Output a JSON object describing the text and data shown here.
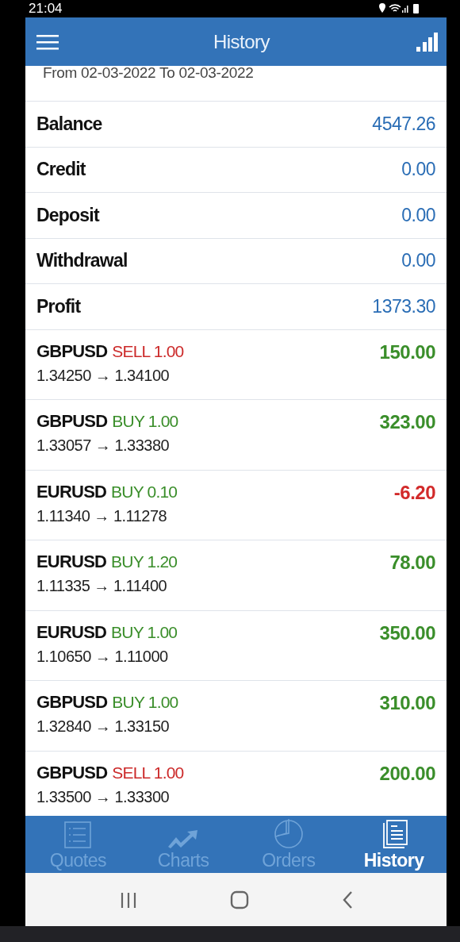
{
  "status_bar": {
    "time": "21:04"
  },
  "app_bar": {
    "title": "History"
  },
  "period": "From 02-03-2022 To 02-03-2022",
  "summary": [
    {
      "label": "Balance",
      "value": "4547.26"
    },
    {
      "label": "Credit",
      "value": "0.00"
    },
    {
      "label": "Deposit",
      "value": "0.00"
    },
    {
      "label": "Withdrawal",
      "value": "0.00"
    },
    {
      "label": "Profit",
      "value": "1373.30"
    }
  ],
  "trades": [
    {
      "symbol": "GBPUSD",
      "side": "SELL 1.00",
      "kind": "sell",
      "prices": "1.34250 → 1.34100",
      "profit": "150.00",
      "color": "#3a8e2a"
    },
    {
      "symbol": "GBPUSD",
      "side": "BUY 1.00",
      "kind": "buy",
      "prices": "1.33057 → 1.33380",
      "profit": "323.00",
      "color": "#3a8e2a"
    },
    {
      "symbol": "EURUSD",
      "side": "BUY 0.10",
      "kind": "buy",
      "prices": "1.11340 → 1.11278",
      "profit": "-6.20",
      "color": "#d22a2a"
    },
    {
      "symbol": "EURUSD",
      "side": "BUY 1.20",
      "kind": "buy",
      "prices": "1.11335 → 1.11400",
      "profit": "78.00",
      "color": "#3a8e2a"
    },
    {
      "symbol": "EURUSD",
      "side": "BUY 1.00",
      "kind": "buy",
      "prices": "1.10650 → 1.11000",
      "profit": "350.00",
      "color": "#3a8e2a"
    },
    {
      "symbol": "GBPUSD",
      "side": "BUY 1.00",
      "kind": "buy",
      "prices": "1.32840 → 1.33150",
      "profit": "310.00",
      "color": "#3a8e2a"
    },
    {
      "symbol": "GBPUSD",
      "side": "SELL 1.00",
      "kind": "sell",
      "prices": "1.33500 → 1.33300",
      "profit": "200.00",
      "color": "#3a8e2a"
    }
  ],
  "bottom_nav": [
    {
      "label": "Quotes",
      "selected": false
    },
    {
      "label": "Charts",
      "selected": false
    },
    {
      "label": "Orders",
      "selected": false
    },
    {
      "label": "History",
      "selected": true
    }
  ]
}
